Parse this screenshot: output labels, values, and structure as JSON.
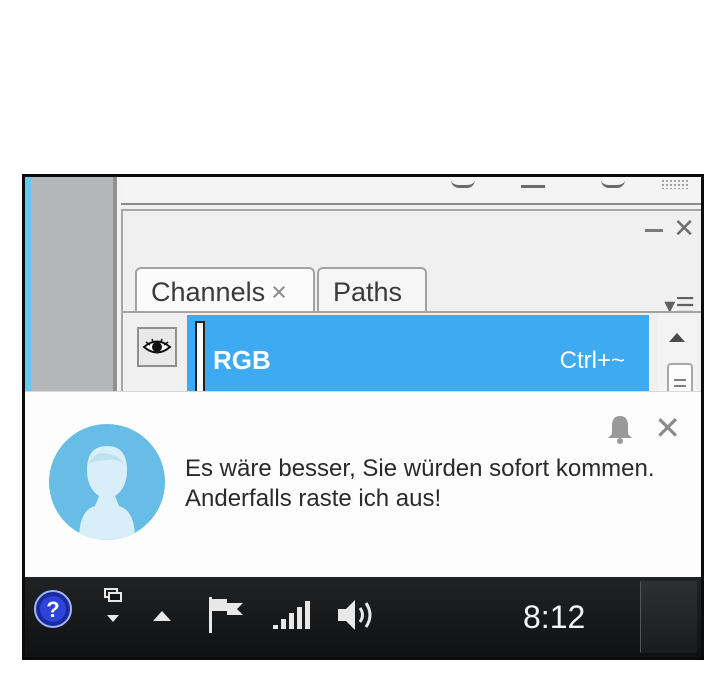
{
  "panel": {
    "tabs": [
      {
        "label": "Channels",
        "close": "×"
      },
      {
        "label": "Paths"
      }
    ],
    "close": "✕",
    "menu": "▾☰",
    "channel": {
      "name": "RGB",
      "shortcut": "Ctrl+~"
    }
  },
  "toast": {
    "message": "Es wäre besser, Sie würden sofort kommen. Anderfalls raste ich aus!",
    "close": "✕"
  },
  "taskbar": {
    "time": "8:12",
    "help": "?"
  },
  "colors": {
    "selection": "#3daaf1",
    "avatar": "#67bde6",
    "taskbar": "#141516"
  },
  "icons": [
    "help-icon",
    "windows-icon",
    "show-hidden-icon",
    "action-center-flag-icon",
    "signal-icon",
    "volume-icon",
    "bell-icon",
    "eye-icon",
    "close-icon",
    "panel-menu-icon"
  ]
}
